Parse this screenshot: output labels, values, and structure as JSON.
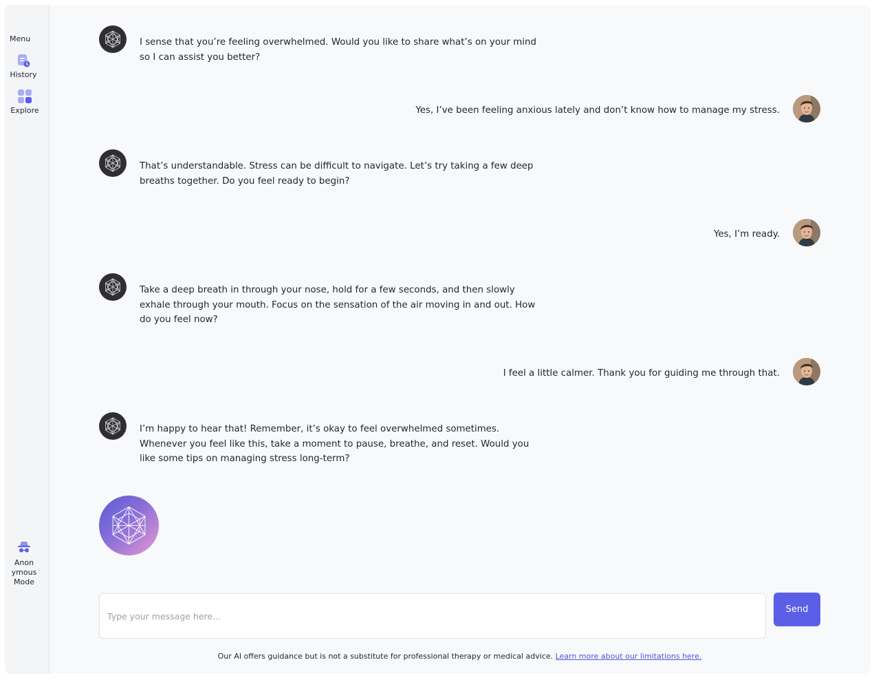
{
  "sidebar": {
    "menu_label": "Menu",
    "items": [
      {
        "label": "History",
        "icon": "history-icon"
      },
      {
        "label": "Explore",
        "icon": "explore-icon"
      }
    ],
    "anonymous_mode": {
      "label_lines": [
        "Anon",
        "ymous",
        "Mode"
      ],
      "icon": "incognito-icon"
    }
  },
  "messages": [
    {
      "role": "assistant",
      "text": "I sense that you’re feeling overwhelmed. Would you like to share what’s on your mind so I can assist you better?"
    },
    {
      "role": "user",
      "text": "Yes, I’ve been feeling anxious lately and don’t know how to manage my stress."
    },
    {
      "role": "assistant",
      "text": "That’s understandable. Stress can be difficult to navigate. Let’s try taking a few deep breaths together. Do you feel ready to begin?"
    },
    {
      "role": "user",
      "text": "Yes, I’m ready."
    },
    {
      "role": "assistant",
      "text": "Take a deep breath in through your nose, hold for a few seconds, and then slowly exhale through your mouth. Focus on the sensation of the air moving in and out. How do you feel now?"
    },
    {
      "role": "user",
      "text": "I feel a little calmer. Thank you for guiding me through that."
    },
    {
      "role": "assistant",
      "text": "I’m happy to hear that! Remember, it’s okay to feel overwhelmed sometimes. Whenever you feel like this, take a moment to pause, breathe, and reset. Would you like some tips on managing stress long-term?"
    }
  ],
  "composer": {
    "placeholder": "Type your message here...",
    "value": "",
    "send_label": "Send"
  },
  "footer": {
    "disclaimer": "Our AI offers guidance but is not a substitute for professional therapy or medical advice.",
    "link_text": "Learn more about our limitations here."
  },
  "colors": {
    "accent": "#5b5fe8",
    "bot_avatar": "#2f2f31",
    "orb_gradient": [
      "#5b5bd6",
      "#8a6ed8",
      "#e59bd0"
    ]
  }
}
